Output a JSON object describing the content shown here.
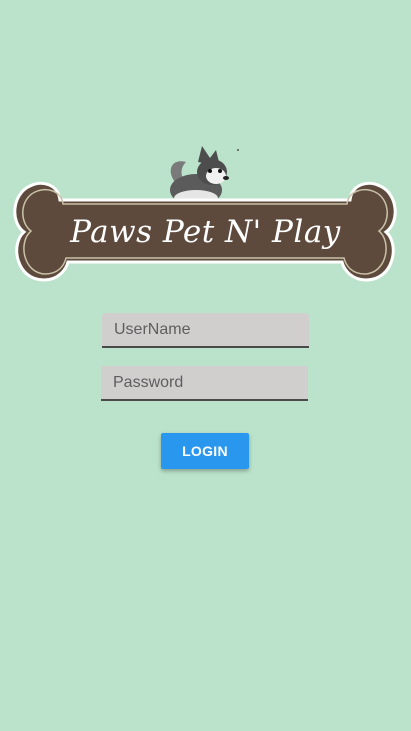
{
  "logo": {
    "text": "Paws Pet N' Play",
    "bone_color": "#5e4a3d",
    "outline_color": "#ffffff"
  },
  "form": {
    "username": {
      "placeholder": "UserName",
      "value": ""
    },
    "password": {
      "placeholder": "Password",
      "value": ""
    },
    "login_label": "LOGIN"
  },
  "colors": {
    "background": "#bbe3cb",
    "field_background": "#d1cece",
    "button": "#2a97ef"
  },
  "icons": [
    "husky-dog-icon",
    "bone-icon"
  ]
}
